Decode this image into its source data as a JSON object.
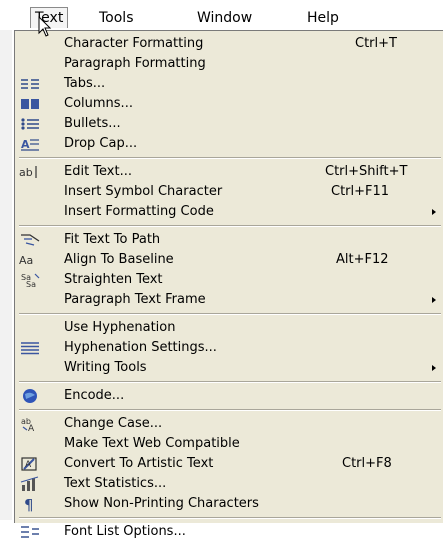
{
  "menubar": [
    {
      "label": "Text",
      "active": true
    },
    {
      "label": "Tools"
    },
    {
      "label": "Window"
    },
    {
      "label": "Help"
    }
  ],
  "menu": {
    "items": [
      {
        "label": "Character Formatting",
        "shortcut": "Ctrl+T",
        "icon": ""
      },
      {
        "label": "Paragraph Formatting",
        "shortcut": "",
        "icon": ""
      },
      {
        "label": "Tabs...",
        "shortcut": "",
        "icon": "tabs-icon"
      },
      {
        "label": "Columns...",
        "shortcut": "",
        "icon": "columns-icon"
      },
      {
        "label": "Bullets...",
        "shortcut": "",
        "icon": "bullets-icon"
      },
      {
        "label": "Drop Cap...",
        "shortcut": "",
        "icon": "drop-cap-icon"
      },
      {
        "label": "Edit Text...",
        "shortcut": "Ctrl+Shift+T",
        "icon": "edit-text-icon"
      },
      {
        "label": "Insert Symbol Character",
        "shortcut": "Ctrl+F11",
        "icon": ""
      },
      {
        "label": "Insert Formatting Code",
        "shortcut": "",
        "icon": "",
        "submenu": true
      },
      {
        "label": "Fit Text To Path",
        "shortcut": "",
        "icon": "fit-text-to-path-icon"
      },
      {
        "label": "Align To Baseline",
        "shortcut": "Alt+F12",
        "icon": "align-baseline-icon"
      },
      {
        "label": "Straighten Text",
        "shortcut": "",
        "icon": "straighten-text-icon"
      },
      {
        "label": "Paragraph Text Frame",
        "shortcut": "",
        "icon": "",
        "submenu": true
      },
      {
        "label": "Use Hyphenation",
        "shortcut": "",
        "icon": ""
      },
      {
        "label": "Hyphenation Settings...",
        "shortcut": "",
        "icon": "hyphenation-icon"
      },
      {
        "label": "Writing Tools",
        "shortcut": "",
        "icon": "",
        "submenu": true
      },
      {
        "label": "Encode...",
        "shortcut": "",
        "icon": "encode-icon"
      },
      {
        "label": "Change Case...",
        "shortcut": "",
        "icon": "change-case-icon"
      },
      {
        "label": "Make Text Web Compatible",
        "shortcut": "",
        "icon": ""
      },
      {
        "label": "Convert To Artistic Text",
        "shortcut": "Ctrl+F8",
        "icon": "convert-artistic-icon"
      },
      {
        "label": "Text Statistics...",
        "shortcut": "",
        "icon": "text-statistics-icon"
      },
      {
        "label": "Show Non-Printing Characters",
        "shortcut": "",
        "icon": "pilcrow-icon"
      },
      {
        "label": "Font List Options...",
        "shortcut": "",
        "icon": "font-list-icon"
      }
    ]
  }
}
